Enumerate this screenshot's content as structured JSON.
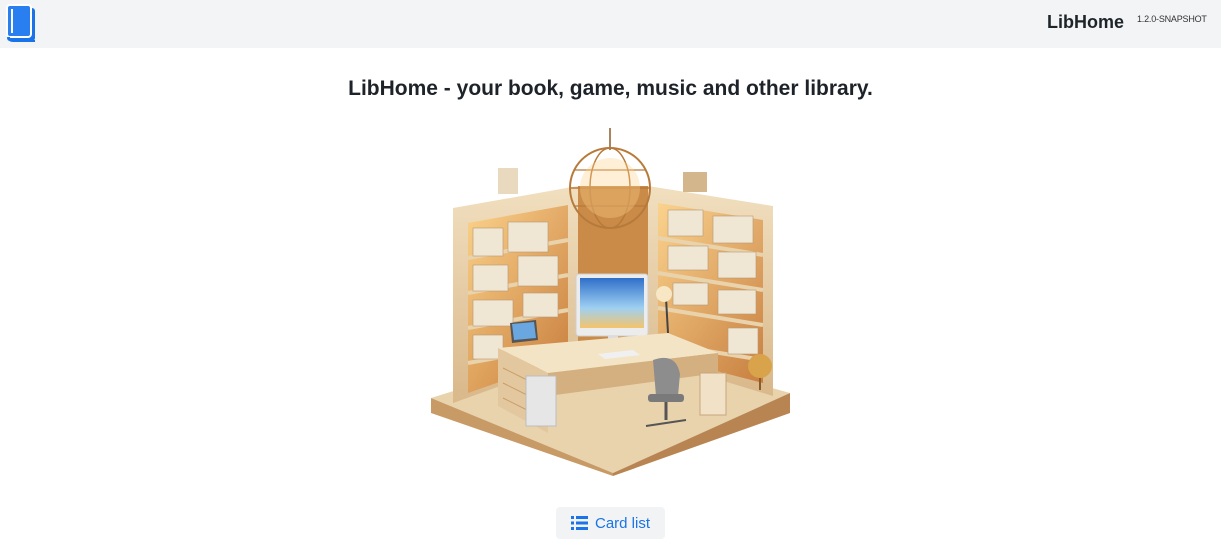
{
  "header": {
    "brand": "LibHome",
    "version": "1.2.0-SNAPSHOT",
    "logo_icon": "book-icon",
    "accent_color": "#1a73e8"
  },
  "main": {
    "heading": "LibHome - your book, game, music and other library.",
    "illustration_icon": "library-room-illustration",
    "card_list_button": {
      "label": "Card list",
      "icon": "list-icon"
    }
  }
}
